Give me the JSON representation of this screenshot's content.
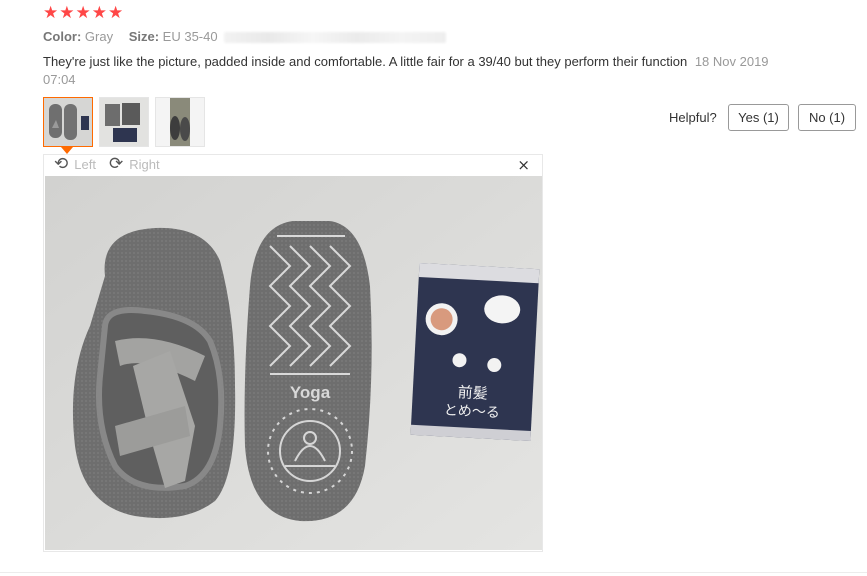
{
  "review": {
    "rating": 5,
    "stars": [
      "★",
      "★",
      "★",
      "★",
      "★"
    ],
    "star_color": "#ff4747",
    "attributes": [
      {
        "label": "Color:",
        "value": "Gray"
      },
      {
        "label": "Size:",
        "value": "EU 35-40"
      }
    ],
    "text": "They're just like the picture, padded inside and comfortable. A little fair for a 39/40 but they perform their function",
    "date": "18 Nov 2019 07:04"
  },
  "thumbnails": [
    {
      "name": "thumbnail-socks-photo",
      "active": true
    },
    {
      "name": "thumbnail-package-photo",
      "active": false
    },
    {
      "name": "thumbnail-worn-photo",
      "active": false
    }
  ],
  "helpful": {
    "label": "Helpful?",
    "yes": "Yes (1)",
    "no": "No (1)"
  },
  "viewer": {
    "rotate_left": "Left",
    "rotate_right": "Right",
    "close": "×",
    "icons": {
      "rotate_left": "rotate-left-icon",
      "rotate_right": "rotate-right-icon",
      "close": "close-icon"
    }
  },
  "photo": {
    "sole_text": "Yoga",
    "package_text_1": "前髪",
    "package_text_2": "とめ〜る"
  },
  "colors": {
    "accent": "#ff6a00",
    "sock_gray": "#6f6f6f",
    "package_navy": "#2e3550"
  }
}
